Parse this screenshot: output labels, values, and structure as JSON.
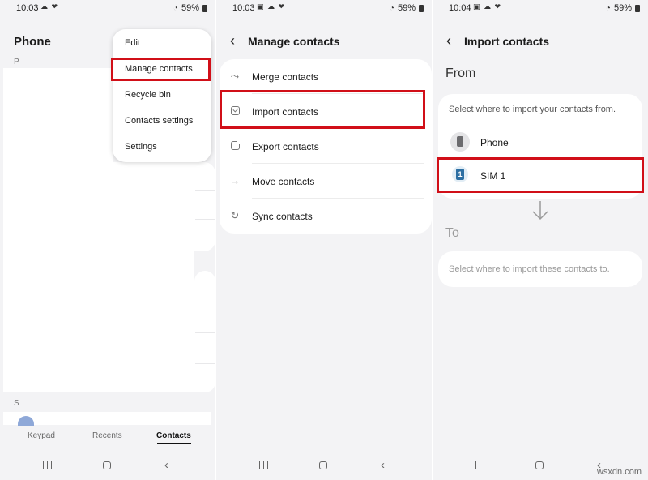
{
  "statusbar": [
    {
      "time": "10:03",
      "icons": "☁ ❤",
      "battery": "59%"
    },
    {
      "time": "10:03",
      "icons": "▣ ☁ ❤",
      "battery": "59%"
    },
    {
      "time": "10:04",
      "icons": "▣ ☁ ❤",
      "battery": "59%"
    }
  ],
  "screen1": {
    "title": "Phone",
    "index_letters": [
      "P",
      "S"
    ],
    "menu": [
      "Edit",
      "Manage contacts",
      "Recycle bin",
      "Contacts settings",
      "Settings"
    ],
    "highlighted_menu_item": "Manage contacts",
    "bottom_tabs": [
      "Keypad",
      "Recents",
      "Contacts"
    ],
    "active_tab": "Contacts"
  },
  "screen2": {
    "title": "Manage contacts",
    "items": [
      {
        "label": "Merge contacts",
        "icon": "merge-icon"
      },
      {
        "label": "Import contacts",
        "icon": "import-icon"
      },
      {
        "label": "Export contacts",
        "icon": "export-icon"
      },
      {
        "label": "Move contacts",
        "icon": "arrow-right-icon"
      },
      {
        "label": "Sync contacts",
        "icon": "sync-icon"
      }
    ],
    "highlighted_item": "Import contacts"
  },
  "screen3": {
    "title": "Import contacts",
    "from_label": "From",
    "from_hint": "Select where to import your contacts from.",
    "sources": [
      {
        "label": "Phone",
        "icon": "phone-icon"
      },
      {
        "label": "SIM 1",
        "icon": "sim-card-icon",
        "badge": "1"
      }
    ],
    "highlighted_source": "SIM 1",
    "to_label": "To",
    "to_hint": "Select where to import these contacts to."
  },
  "colors": {
    "highlight": "#d10f18",
    "background": "#f3f3f5",
    "card": "#ffffff"
  },
  "watermark": "wsxdn.com"
}
